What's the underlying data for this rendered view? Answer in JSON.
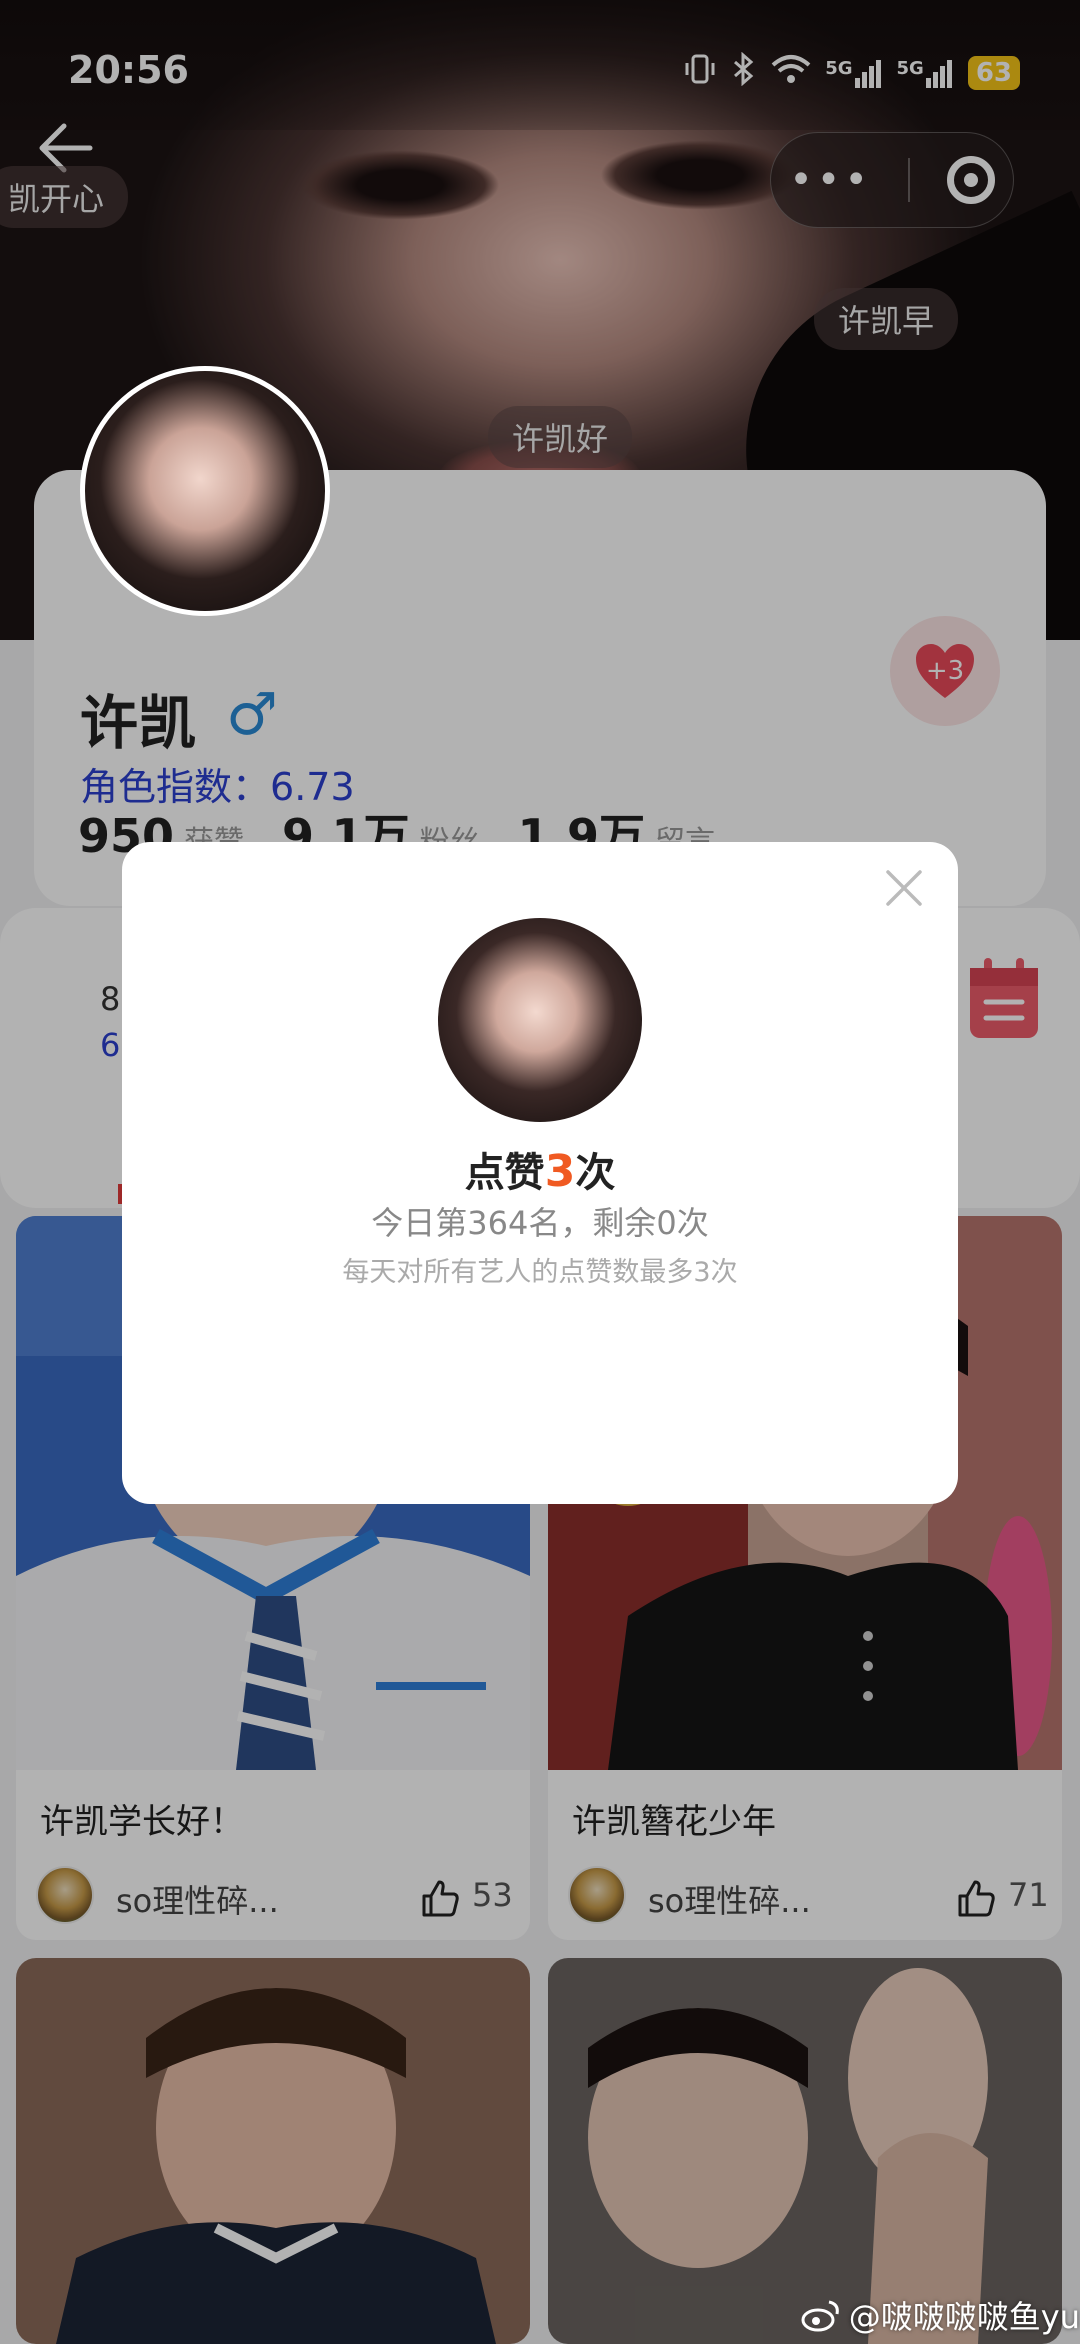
{
  "status": {
    "time": "20:56",
    "network_1": "5G",
    "network_2": "5G",
    "battery": "63"
  },
  "danmu": [
    "凯开心",
    "许凯早",
    "许凯好"
  ],
  "profile": {
    "name": "许凯",
    "index_label": "角色指数：",
    "index_value": "6.73",
    "stats": [
      {
        "value": "950",
        "label": "获赞"
      },
      {
        "value": "9.1万",
        "label": "粉丝"
      },
      {
        "value": "1.9万",
        "label": "留言"
      }
    ],
    "like_badge": "+3"
  },
  "calendar": {
    "line1": "8",
    "line2": "6"
  },
  "posts": [
    {
      "title": "许凯学长好！",
      "author": "so理性碎...",
      "likes": "53"
    },
    {
      "title": "许凯簪花少年",
      "author": "so理性碎...",
      "likes": "71"
    }
  ],
  "modal": {
    "title_prefix": "点赞",
    "title_count": "3",
    "title_suffix": "次",
    "subtitle": "今日第364名，剩余0次",
    "note": "每天对所有艺人的点赞数最多3次"
  },
  "watermark": "@啵啵啵啵鱼yu",
  "colors": {
    "accent_orange": "#f05a22",
    "index_blue": "#2b3fcf",
    "heart_red": "#e84a5a",
    "male_blue": "#2a8ad4"
  }
}
